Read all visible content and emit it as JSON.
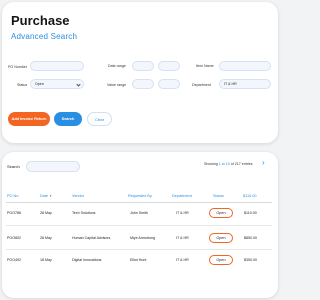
{
  "header": {
    "title": "Purchase",
    "subtitle": "Advanced Search"
  },
  "form": {
    "po_number_label": "PO Number",
    "date_range_label": "Date range",
    "item_name_label": "Item Name",
    "status_label": "Status",
    "status_value": "Open",
    "value_range_label": "Value range",
    "department_label": "Department",
    "department_value": "IT & HR"
  },
  "buttons": {
    "add_label": "Add Invoice Return",
    "search_label": "Search",
    "clear_label": "Clear"
  },
  "table_controls": {
    "search_label": "Search",
    "showing_prefix": "Showing ",
    "showing_range": "1 to 10",
    "showing_suffix": " of 217 entries"
  },
  "table": {
    "headers": [
      "PO No",
      "Date",
      "Vendor",
      "Requested By",
      "Department",
      "Status",
      "$110.00"
    ],
    "rows": [
      {
        "po": "POO786",
        "date": "28 May",
        "vendor": "Tech Solutions",
        "requested_by": "John Smith",
        "department": "IT & HR",
        "status": "Open",
        "amount": "$110.00"
      },
      {
        "po": "POO802",
        "date": "28 May",
        "vendor": "Human Capital Advisors",
        "requested_by": "Miye Armstrong",
        "department": "IT & HR",
        "status": "Open",
        "amount": "$850.00"
      },
      {
        "po": "POO492",
        "date": "18 May",
        "vendor": "Digital Innovations",
        "requested_by": "Elliot Hunt",
        "department": "IT & HR",
        "status": "Open",
        "amount": "$350.00"
      }
    ]
  },
  "colors": {
    "accent_blue": "#2a8fe3",
    "accent_orange": "#f26522"
  },
  "icons": {
    "next": "chevron-right-icon",
    "sort": "sort-down-icon"
  }
}
